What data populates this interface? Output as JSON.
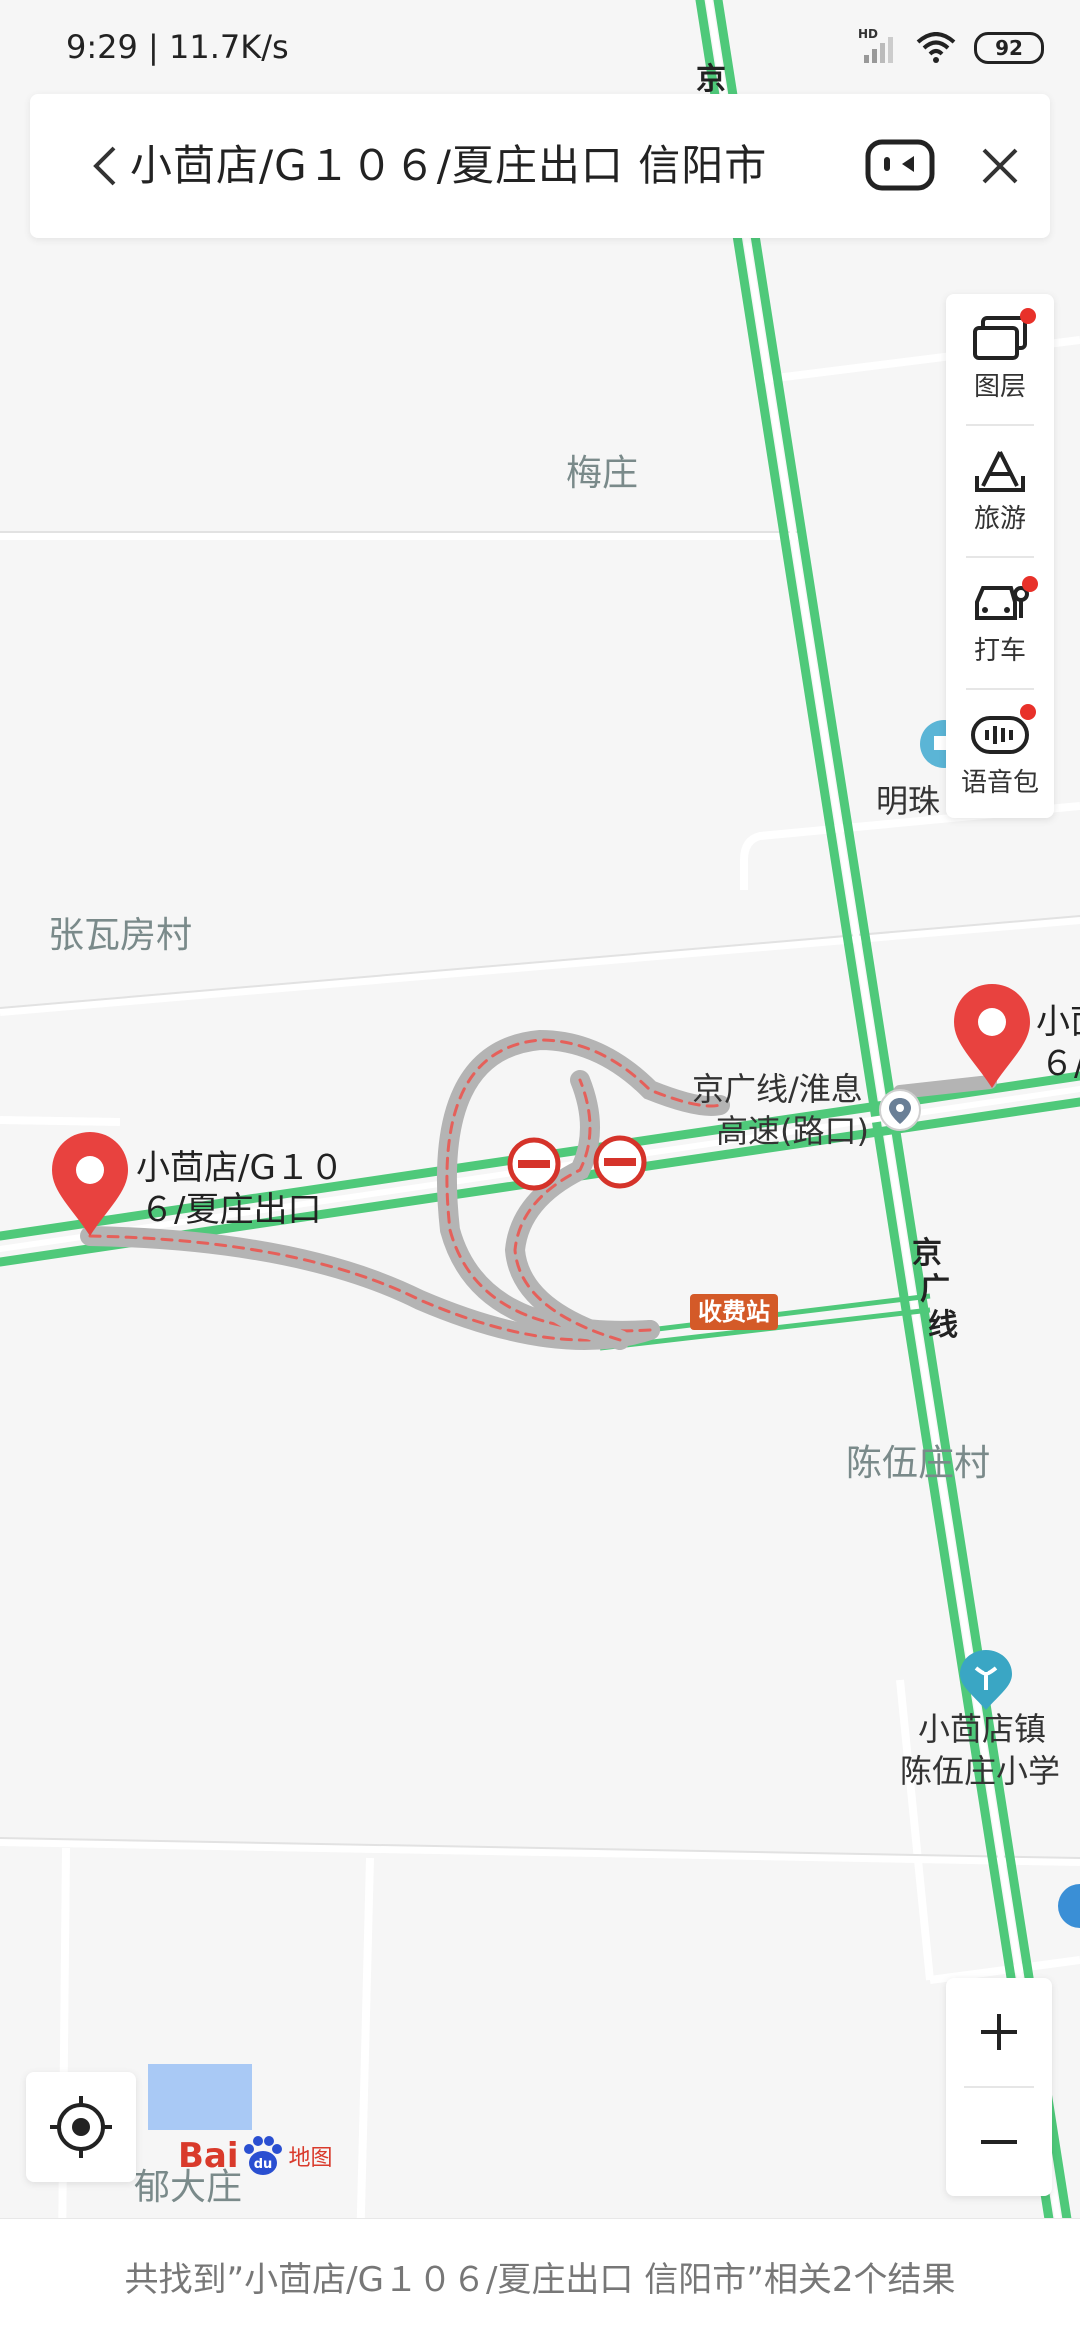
{
  "status_bar": {
    "time": "9:29",
    "speed": "11.7K/s",
    "battery": "92",
    "hd_badge": "HD"
  },
  "search": {
    "query": "小茴店/G１０６/夏庄出口 信阳市"
  },
  "toolbar": {
    "layers_label": "图层",
    "travel_label": "旅游",
    "taxi_label": "打车",
    "voice_pack_label": "语音包"
  },
  "map": {
    "places": {
      "meizhuang": "梅庄",
      "zhangwafang": "张瓦房村",
      "chenwuzhuang": "陈伍庄村",
      "yuzhuang": "郁大庄",
      "mingzhu": "明珠"
    },
    "roads": {
      "jing_top": "京",
      "jingguang_char1": "京",
      "jingguang_char2": "广",
      "jingguang_char3": "线",
      "junction_line1": "京广线/淮息",
      "junction_line2": "高速(路口)",
      "toll": "收费站"
    },
    "pois": {
      "school_line1": "小茴店镇",
      "school_line2": "陈伍庄小学"
    },
    "results": {
      "result_a_line1": "小茴店/G１０",
      "result_a_line2": "６/夏庄出口",
      "result_b_line1": "小茴",
      "result_b_line2": "６/"
    },
    "colors": {
      "road_green": "#4fc97a",
      "marker_red": "#e8423f",
      "route_gray": "#b4b4b4",
      "toll_orange": "#d45a28"
    }
  },
  "zoom": {
    "in": "+",
    "out": "−"
  },
  "brand": {
    "logo_text": "Bai",
    "logo_du": "du",
    "logo_map": "地图"
  },
  "bottom": {
    "summary": "共找到”小茴店/G１０６/夏庄出口 信阳市”相关2个结果"
  }
}
